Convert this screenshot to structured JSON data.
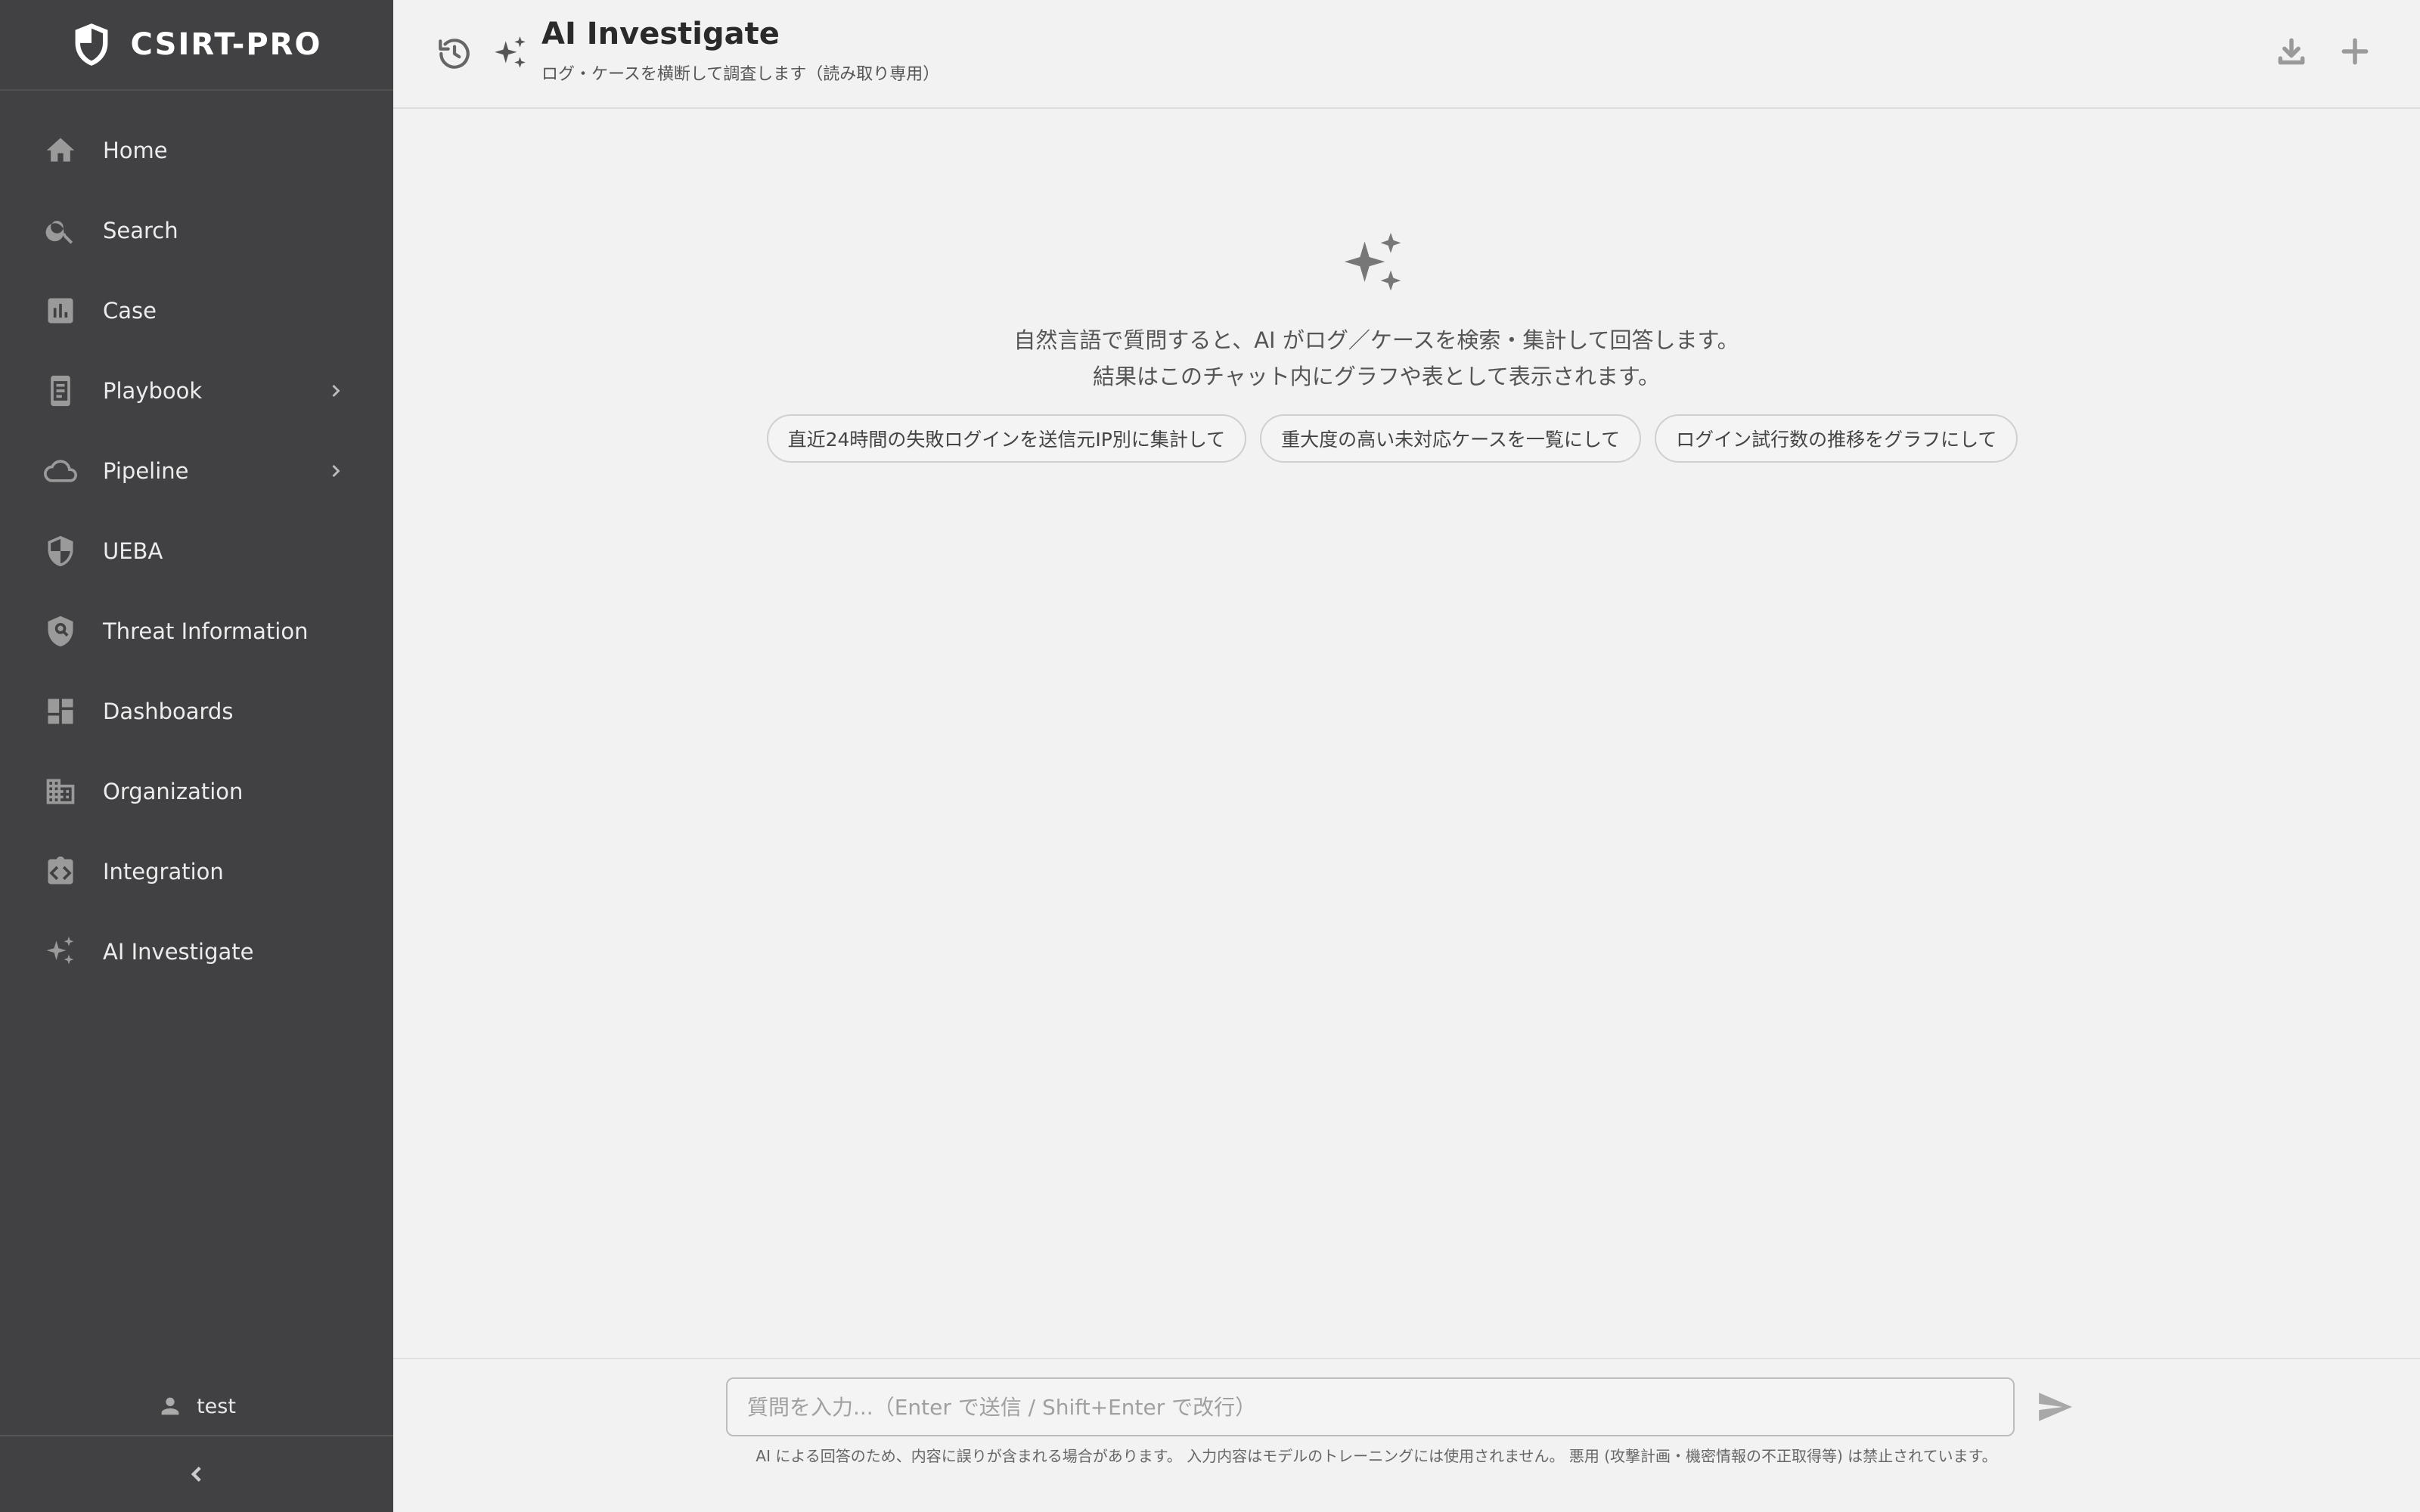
{
  "brand": {
    "name": "CSIRT-PRO"
  },
  "sidebar": {
    "items": [
      {
        "label": "Home"
      },
      {
        "label": "Search"
      },
      {
        "label": "Case"
      },
      {
        "label": "Playbook"
      },
      {
        "label": "Pipeline"
      },
      {
        "label": "UEBA"
      },
      {
        "label": "Threat Information"
      },
      {
        "label": "Dashboards"
      },
      {
        "label": "Organization"
      },
      {
        "label": "Integration"
      },
      {
        "label": "AI Investigate"
      }
    ],
    "user": "test"
  },
  "header": {
    "title": "AI Investigate",
    "subtitle": "ログ・ケースを横断して調査します（読み取り専用）"
  },
  "main": {
    "intro": "自然言語で質問すると、AI がログ／ケースを検索・集計して回答します。 結果はこのチャット内にグラフや表として表示されます。",
    "suggestions": [
      "直近24時間の失敗ログインを送信元IP別に集計して",
      "重大度の高い未対応ケースを一覧にして",
      "ログイン試行数の推移をグラフにして"
    ]
  },
  "footer": {
    "input_placeholder": "質問を入力...（Enter で送信 / Shift+Enter で改行）",
    "disclaimer": "AI による回答のため、内容に誤りが含まれる場合があります。 入力内容はモデルのトレーニングには使用されません。 悪用 (攻撃計画・機密情報の不正取得等) は禁止されています。"
  },
  "icons": {
    "brand": "shield-icon",
    "history": "history-icon",
    "sparkle": "sparkle-icon",
    "download": "download-icon",
    "add": "plus-icon",
    "send": "send-icon",
    "user": "person-icon",
    "collapse": "chevron-left-icon"
  }
}
